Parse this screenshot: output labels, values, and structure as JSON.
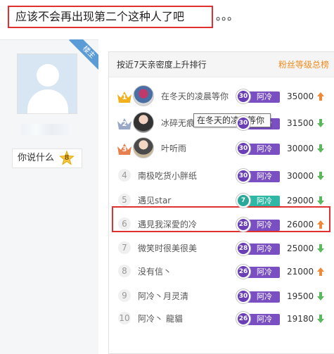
{
  "post": {
    "title": "应该不会再出现第二个这种人了吧",
    "title_tail": "。。。"
  },
  "user": {
    "badge": "楼主",
    "signature": "你说什么",
    "level": "8"
  },
  "ranking": {
    "header_left": "按近7天亲密度上升排行",
    "header_right": "粉丝等级总榜",
    "tooltip": "在冬天的凌晨等你",
    "rows": [
      {
        "rank": "1",
        "name": "在冬天的凌晨等你",
        "level": "30",
        "fan_name": "阿冷",
        "score": "35000",
        "trend": "up"
      },
      {
        "rank": "2",
        "name": "冰碎无痕",
        "level": "30",
        "fan_name": "阿冷",
        "score": "31500",
        "trend": "down"
      },
      {
        "rank": "3",
        "name": "叶听雨",
        "level": "30",
        "fan_name": "阿冷",
        "score": "30000",
        "trend": "down"
      },
      {
        "rank": "4",
        "name": "南极吃货小胖纸",
        "level": "30",
        "fan_name": "阿冷",
        "score": "30000",
        "trend": "down"
      },
      {
        "rank": "5",
        "name": "遇见star",
        "level": "7",
        "fan_name": "阿冷",
        "score": "29000",
        "trend": "down"
      },
      {
        "rank": "6",
        "name": "遇見我深愛的冷",
        "level": "28",
        "fan_name": "阿冷",
        "score": "26000",
        "trend": "up"
      },
      {
        "rank": "7",
        "name": "微笑时很美很美",
        "level": "28",
        "fan_name": "阿冷",
        "score": "25000",
        "trend": "down"
      },
      {
        "rank": "8",
        "name": "没有信丶",
        "level": "26",
        "fan_name": "阿冷",
        "score": "21000",
        "trend": "up"
      },
      {
        "rank": "9",
        "name": "阿冷丶月灵清",
        "level": "30",
        "fan_name": "阿冷",
        "score": "19500",
        "trend": "down"
      },
      {
        "rank": "10",
        "name": "阿冷丶 龍貓",
        "level": "26",
        "fan_name": "阿冷",
        "score": "19180",
        "trend": "down"
      }
    ]
  },
  "colors": {
    "highlight": "#e03030",
    "up": "#f0883a",
    "down": "#5cb85c",
    "tag_purple": "#7a4fc2",
    "tag_teal": "#2fb8a6",
    "badge": "#5b9bd6"
  }
}
